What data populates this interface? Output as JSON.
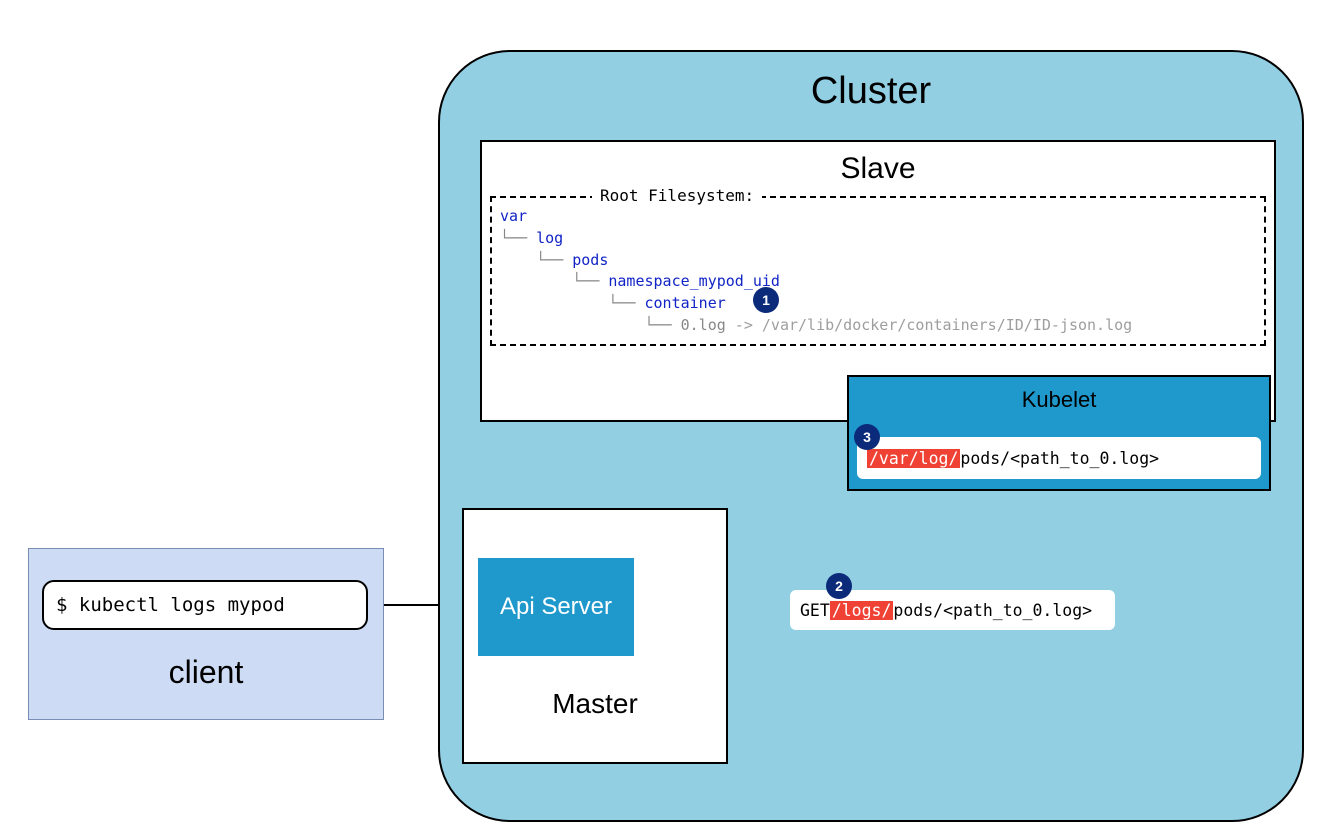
{
  "cluster": {
    "title": "Cluster"
  },
  "slave": {
    "title": "Slave",
    "fs_legend": "Root Filesystem:",
    "tree": {
      "var": "var",
      "log": "log",
      "pods": "pods",
      "ns": "namespace_mypod_uid",
      "container": "container",
      "file": "0.log",
      "symlink": " -> /var/lib/docker/containers/ID/ID-json.log"
    }
  },
  "kubelet": {
    "title": "Kubelet",
    "path_prefix_hl": "/var/log/",
    "path_rest": "pods/<path_to_0.log>"
  },
  "master": {
    "title": "Master",
    "api_server": "Api Server"
  },
  "client": {
    "title": "client",
    "command": "$ kubectl logs mypod"
  },
  "request": {
    "method": "GET ",
    "path_hl": "/logs/",
    "path_rest": "pods/<path_to_0.log>"
  },
  "steps": {
    "s1": "1",
    "s2": "2",
    "s3": "3"
  }
}
